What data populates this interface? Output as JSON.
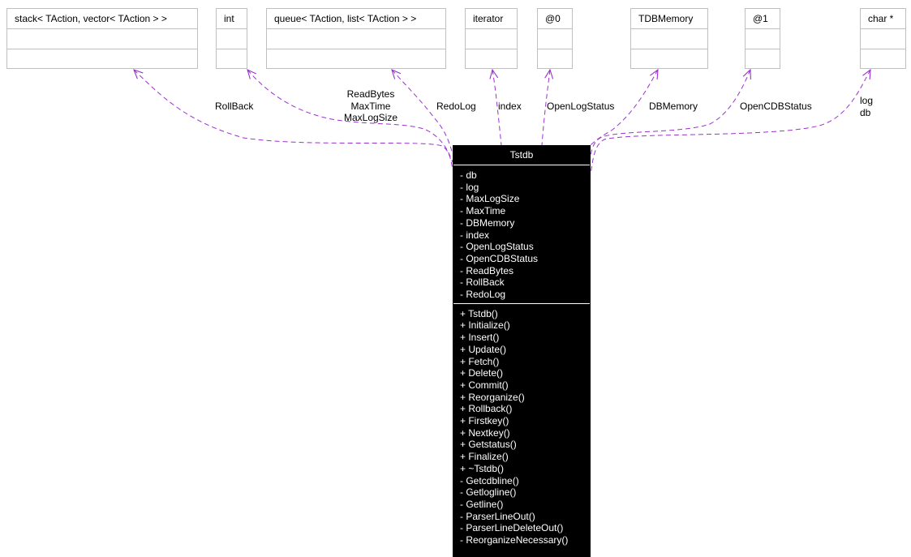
{
  "colors": {
    "edge": "#9a32cd",
    "box_border": "#bfbfbf",
    "main_bg": "#000000",
    "main_fg": "#ffffff"
  },
  "related_classes": [
    {
      "id": "stack",
      "name": "stack< TAction, vector< TAction > >"
    },
    {
      "id": "int",
      "name": "int"
    },
    {
      "id": "queue",
      "name": "queue< TAction, list< TAction > >"
    },
    {
      "id": "iterator",
      "name": "iterator"
    },
    {
      "id": "at0",
      "name": "@0"
    },
    {
      "id": "tdbmemory",
      "name": "TDBMemory"
    },
    {
      "id": "at1",
      "name": "@1"
    },
    {
      "id": "charptr",
      "name": "char *"
    }
  ],
  "edge_labels": {
    "stack": "RollBack",
    "int": [
      "ReadBytes",
      "MaxTime",
      "MaxLogSize"
    ],
    "queue": "RedoLog",
    "iterator": "index",
    "at0": "OpenLogStatus",
    "tdbmemory": "DBMemory",
    "at1": "OpenCDBStatus",
    "charptr": [
      "log",
      "db"
    ]
  },
  "main_class": {
    "name": "Tstdb",
    "attributes": [
      "- db",
      "- log",
      "- MaxLogSize",
      "- MaxTime",
      "- DBMemory",
      "- index",
      "- OpenLogStatus",
      "- OpenCDBStatus",
      "- ReadBytes",
      "- RollBack",
      "- RedoLog"
    ],
    "methods": [
      "+ Tstdb()",
      "+ Initialize()",
      "+ Insert()",
      "+ Update()",
      "+ Fetch()",
      "+ Delete()",
      "+ Commit()",
      "+ Reorganize()",
      "+ Rollback()",
      "+ Firstkey()",
      "+ Nextkey()",
      "+ Getstatus()",
      "+ Finalize()",
      "+ ~Tstdb()",
      "- Getcdbline()",
      "- Getlogline()",
      "- Getline()",
      "- ParserLineOut()",
      "- ParserLineDeleteOut()",
      "- ReorganizeNecessary()"
    ]
  }
}
